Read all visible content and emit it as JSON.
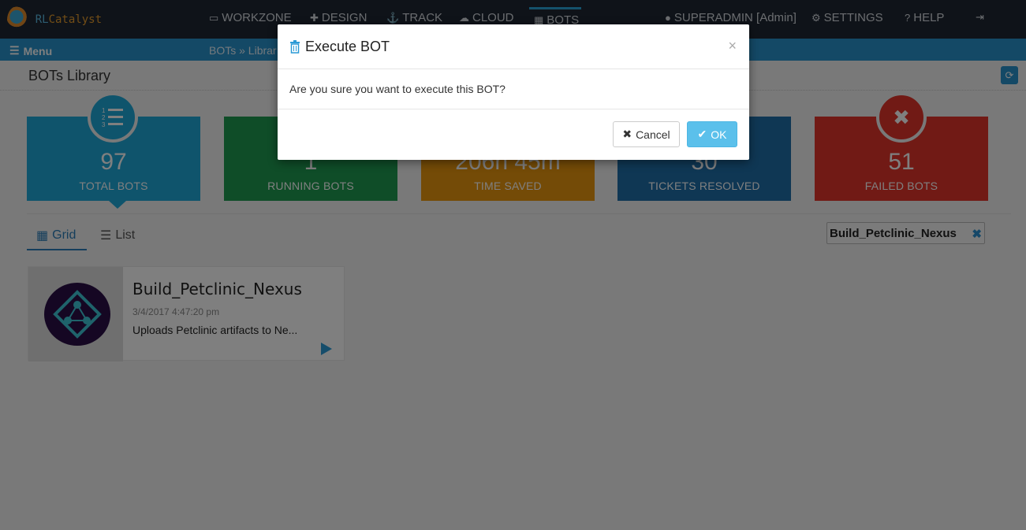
{
  "brand": {
    "logo_text_a": "RL",
    "logo_text_b": "Catalyst"
  },
  "topnav": {
    "items": [
      {
        "label": "WORKZONE",
        "icon": "workzone-icon"
      },
      {
        "label": "DESIGN",
        "icon": "puzzle-icon"
      },
      {
        "label": "TRACK",
        "icon": "anchor-icon"
      },
      {
        "label": "CLOUD",
        "icon": "cloud-icon"
      },
      {
        "label": "BOTS",
        "icon": "bots-icon"
      }
    ],
    "active": "BOTS",
    "user": "SUPERADMIN [Admin]",
    "settings": "SETTINGS",
    "help": "HELP"
  },
  "subbar": {
    "menu_label": "Menu",
    "breadcrumb": "BOTs » Librar"
  },
  "page": {
    "title": "BOTs Library"
  },
  "stats": [
    {
      "value": "97",
      "label": "TOTAL BOTS",
      "color": "#1fa9d8",
      "icon": "numbered-list-icon"
    },
    {
      "value": "1",
      "label": "RUNNING BOTS",
      "color": "#1e9a50"
    },
    {
      "value": "206h 45m",
      "label": "TIME SAVED",
      "color": "#e8960f"
    },
    {
      "value": "30",
      "label": "TICKETS RESOLVED",
      "color": "#1f6fa8"
    },
    {
      "value": "51",
      "label": "FAILED BOTS",
      "color": "#e2352b",
      "icon": "times-icon"
    }
  ],
  "view_tabs": {
    "grid": "Grid",
    "list": "List",
    "active": "Grid"
  },
  "filter": {
    "value": "Build_Petclinic_Nexus",
    "clear": "✖"
  },
  "bots": [
    {
      "name": "Build_Petclinic_Nexus",
      "date": "3/4/2017 4:47:20 pm",
      "description": "Uploads Petclinic artifacts to Ne..."
    }
  ],
  "modal": {
    "title": "Execute BOT",
    "close": "×",
    "message": "Are you sure you want to execute this BOT?",
    "cancel_label": "Cancel",
    "ok_label": "OK"
  }
}
